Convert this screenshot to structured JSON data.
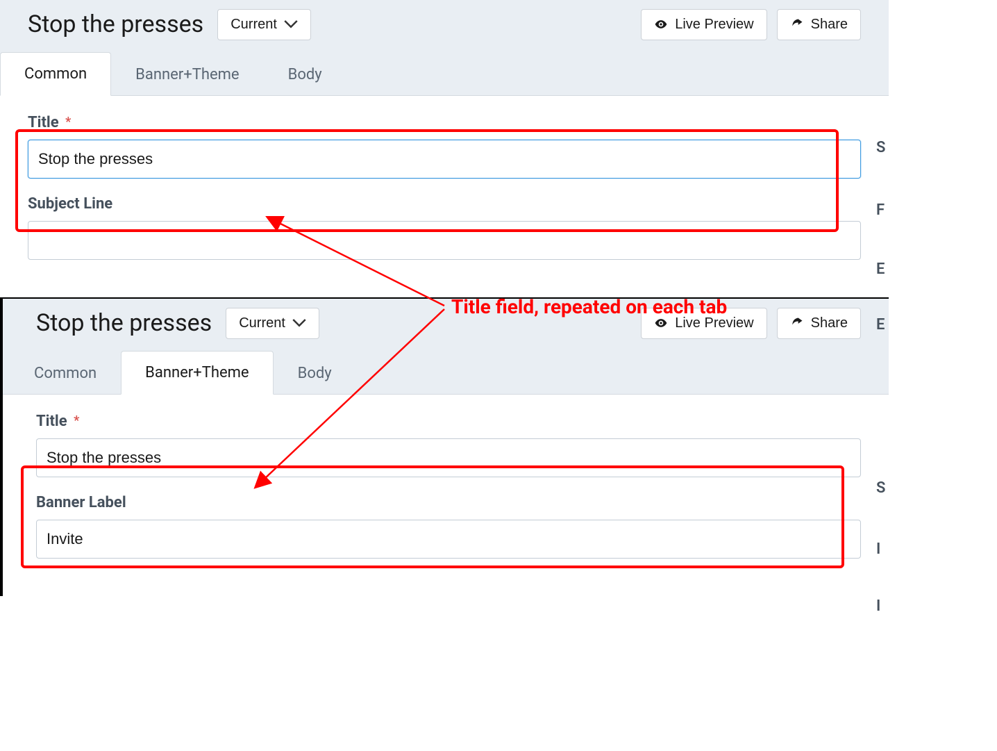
{
  "top": {
    "header": {
      "title": "Stop the presses",
      "version_label": "Current",
      "preview_label": "Live Preview",
      "share_label": "Share"
    },
    "tabs": [
      "Common",
      "Banner+Theme",
      "Body"
    ],
    "active_tab_index": 0,
    "fields": {
      "title_label": "Title",
      "title_value": "Stop the presses",
      "subject_label": "Subject Line",
      "subject_value": ""
    }
  },
  "bottom": {
    "header": {
      "title": "Stop the presses",
      "version_label": "Current",
      "preview_label": "Live Preview",
      "share_label": "Share"
    },
    "tabs": [
      "Common",
      "Banner+Theme",
      "Body"
    ],
    "active_tab_index": 1,
    "fields": {
      "title_label": "Title",
      "title_value": "Stop the presses",
      "banner_label_label": "Banner Label",
      "banner_label_value": "Invite"
    }
  },
  "annotation": {
    "text": "Title field, repeated on each tab"
  },
  "required_mark": "*",
  "side_letters": [
    "S",
    "F",
    "E",
    "E",
    "S",
    "I",
    "I"
  ]
}
